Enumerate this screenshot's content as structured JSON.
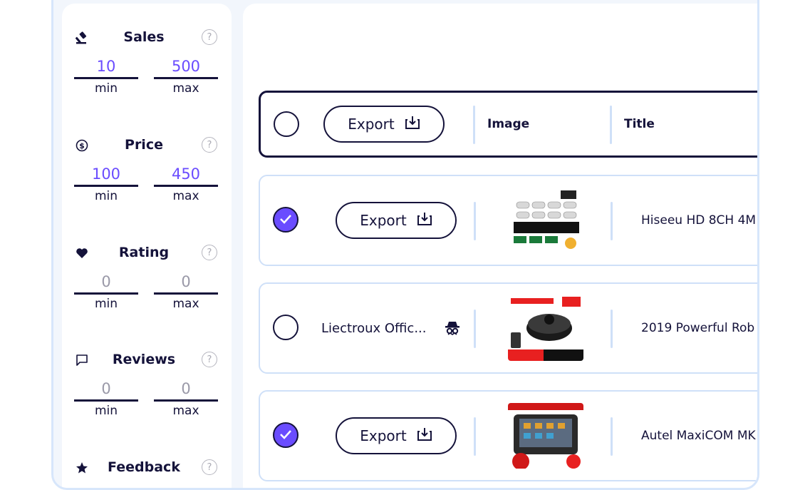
{
  "filters": [
    {
      "key": "sales",
      "title": "Sales",
      "icon": "gavel-icon",
      "min": "10",
      "max": "500",
      "min_label": "min",
      "max_label": "max",
      "help": "?"
    },
    {
      "key": "price",
      "title": "Price",
      "icon": "dollar-coin-icon",
      "min": "100",
      "max": "450",
      "min_label": "min",
      "max_label": "max",
      "help": "?"
    },
    {
      "key": "rating",
      "title": "Rating",
      "icon": "heart-icon",
      "min": "0",
      "max": "0",
      "min_label": "min",
      "max_label": "max",
      "help": "?"
    },
    {
      "key": "reviews",
      "title": "Reviews",
      "icon": "chat-bubble-icon",
      "min": "0",
      "max": "0",
      "min_label": "min",
      "max_label": "max",
      "help": "?"
    },
    {
      "key": "feedback",
      "title": "Feedback",
      "icon": "star-icon",
      "help": "?"
    }
  ],
  "table": {
    "header": {
      "export_label": "Export",
      "col_image": "Image",
      "col_title": "Title"
    },
    "rows": [
      {
        "selected": true,
        "action": "Export",
        "image": "security-camera-kit-thumbnail",
        "title": "Hiseeu HD 8CH 4M"
      },
      {
        "selected": false,
        "store": "Liectroux Offic...",
        "image": "robot-vacuum-thumbnail",
        "title": "2019 Powerful Rob"
      },
      {
        "selected": true,
        "action": "Export",
        "image": "diagnostic-tablet-thumbnail",
        "title": "Autel MaxiCOM MK"
      }
    ]
  },
  "colors": {
    "accent": "#6a4cff",
    "ink": "#14123a",
    "border_light": "#cfe0f8",
    "frame_bg": "#f2f6fc"
  }
}
